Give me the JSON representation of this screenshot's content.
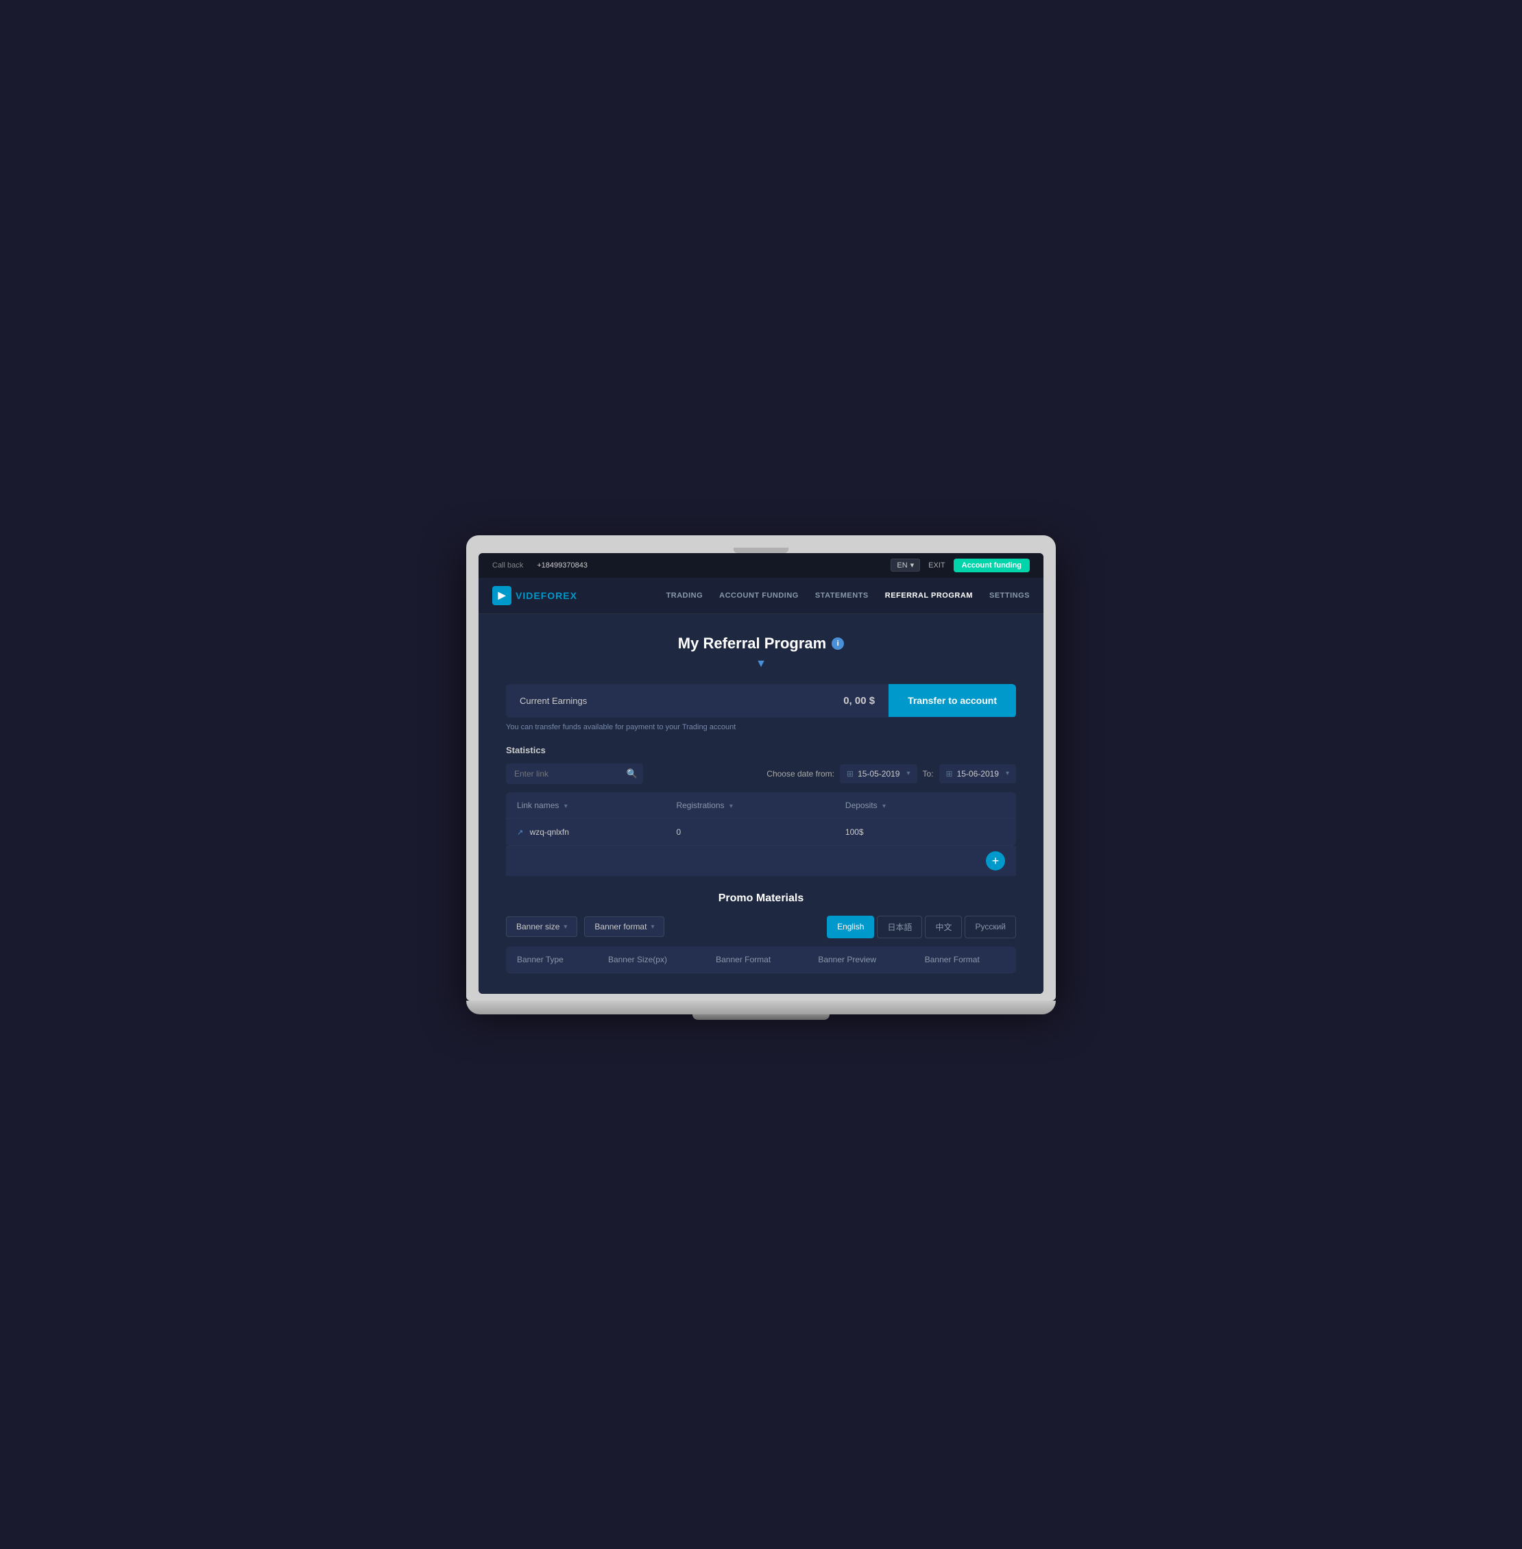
{
  "topbar": {
    "callback_label": "Call back",
    "phone": "+18499370843",
    "lang": "EN",
    "exit_label": "EXIT",
    "account_funding_label": "Account funding"
  },
  "nav": {
    "logo_text_first": "VIDE",
    "logo_text_second": "FOREX",
    "links": [
      {
        "label": "TRADING",
        "active": false
      },
      {
        "label": "ACCOUNT FUNDING",
        "active": false
      },
      {
        "label": "STATEMENTS",
        "active": false
      },
      {
        "label": "REFERRAL PROGRAM",
        "active": true
      },
      {
        "label": "SETTINGS",
        "active": false
      }
    ]
  },
  "page": {
    "title": "My Referral Program",
    "earnings_label": "Current Earnings",
    "earnings_value": "0, 00 $",
    "transfer_btn": "Transfer to account",
    "transfer_hint": "You can transfer funds available for payment to your Trading account",
    "statistics_title": "Statistics",
    "search_placeholder": "Enter link",
    "date_from_label": "Choose date from:",
    "date_from": "15-05-2019",
    "date_to_label": "To:",
    "date_to": "15-06-2019",
    "table_headers": [
      "Link names",
      "Registrations",
      "Deposits"
    ],
    "table_rows": [
      {
        "link": "wzq-qnlxfn",
        "registrations": "0",
        "deposits": "100$"
      }
    ],
    "promo_title": "Promo Materials",
    "banner_size_label": "Banner size",
    "banner_format_label": "Banner format",
    "lang_tabs": [
      {
        "label": "English",
        "active": true
      },
      {
        "label": "日本語",
        "active": false
      },
      {
        "label": "中文",
        "active": false
      },
      {
        "label": "Русский",
        "active": false
      }
    ],
    "banner_table_headers": [
      "Banner Type",
      "Banner Size(px)",
      "Banner Format",
      "Banner Preview",
      "Banner Format"
    ]
  }
}
